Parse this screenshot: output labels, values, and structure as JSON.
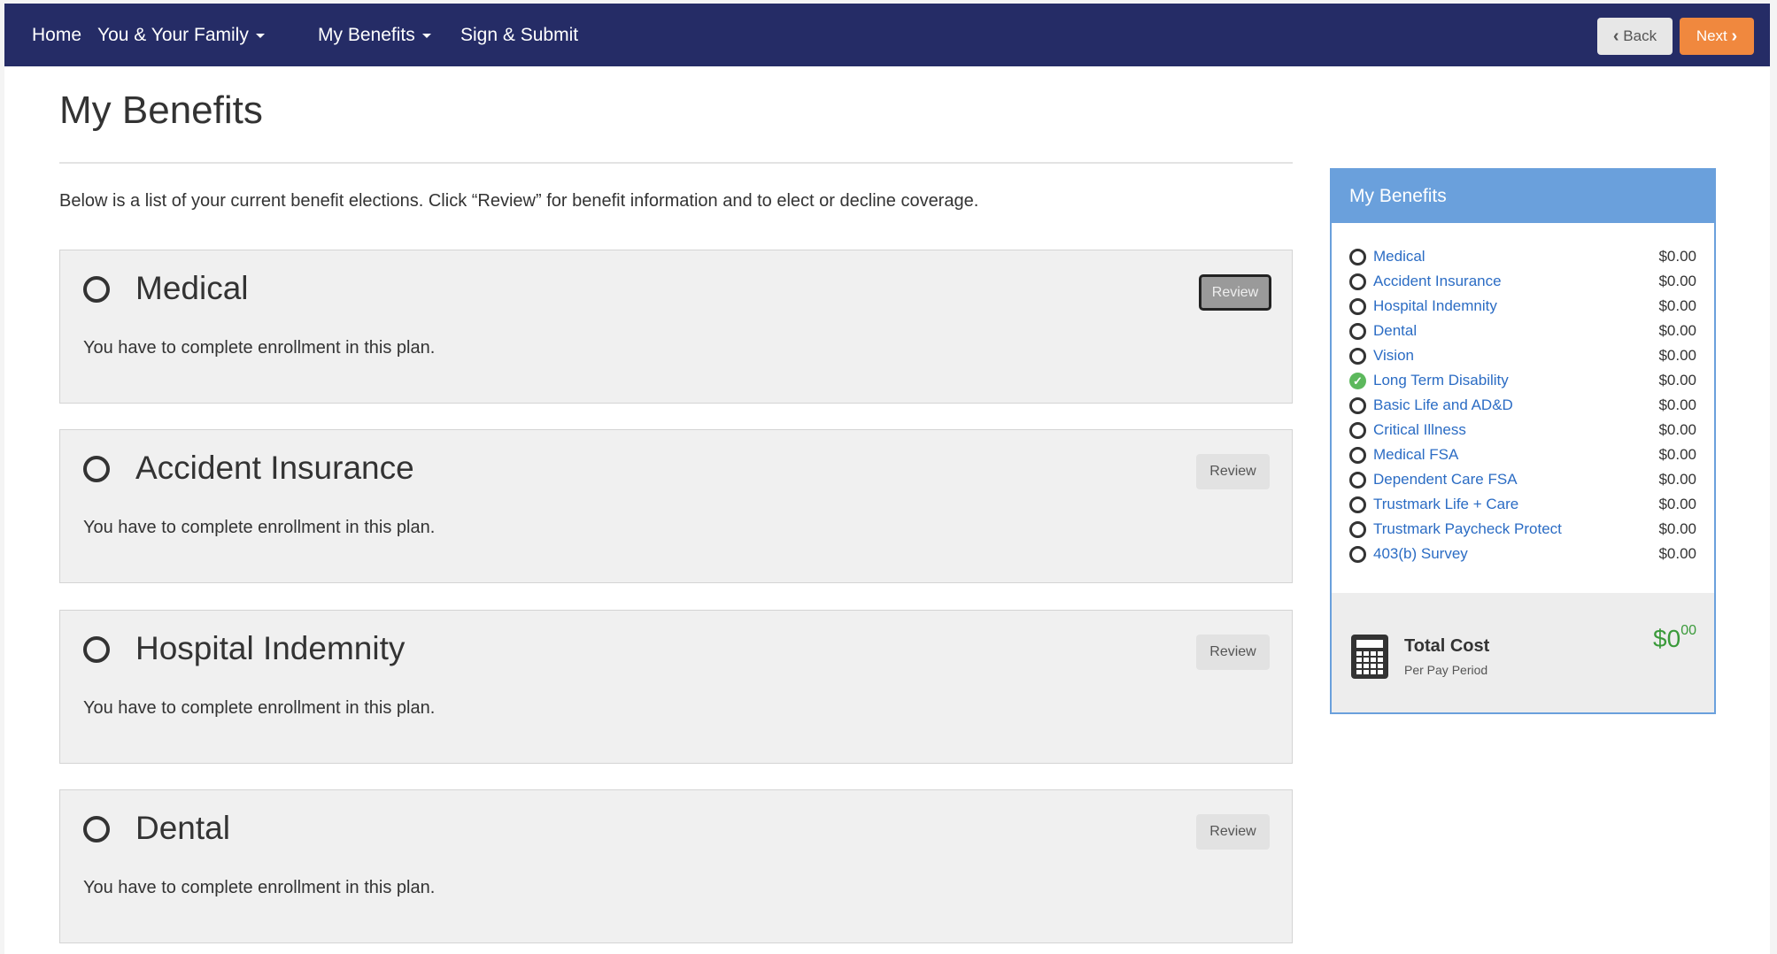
{
  "nav": {
    "items": [
      {
        "label": "Home",
        "dropdown": false
      },
      {
        "label": "You & Your Family",
        "dropdown": true
      },
      {
        "label": "My Benefits",
        "dropdown": true
      },
      {
        "label": "Sign & Submit",
        "dropdown": false
      }
    ],
    "back_label": "Back",
    "next_label": "Next",
    "back_icon": "chevron-left-icon",
    "next_icon": "chevron-right-icon"
  },
  "page": {
    "title": "My Benefits",
    "intro": "Below is a list of your current benefit elections.  Click “Review” for benefit information and to elect or decline coverage."
  },
  "plans": [
    {
      "name": "Medical",
      "status": "You have to complete enrollment in this plan.",
      "review_label": "Review"
    },
    {
      "name": "Accident Insurance",
      "status": "You have to complete enrollment in this plan.",
      "review_label": "Review"
    },
    {
      "name": "Hospital Indemnity",
      "status": "You have to complete enrollment in this plan.",
      "review_label": "Review"
    },
    {
      "name": "Dental",
      "status": "You have to complete enrollment in this plan.",
      "review_label": "Review"
    }
  ],
  "sidebar": {
    "title": "My Benefits",
    "items": [
      {
        "label": "Medical",
        "price": "$0.00",
        "completed": false
      },
      {
        "label": "Accident Insurance",
        "price": "$0.00",
        "completed": false
      },
      {
        "label": "Hospital Indemnity",
        "price": "$0.00",
        "completed": false
      },
      {
        "label": "Dental",
        "price": "$0.00",
        "completed": false
      },
      {
        "label": "Vision",
        "price": "$0.00",
        "completed": false
      },
      {
        "label": "Long Term Disability",
        "price": "$0.00",
        "completed": true
      },
      {
        "label": "Basic Life and AD&D",
        "price": "$0.00",
        "completed": false
      },
      {
        "label": "Critical Illness",
        "price": "$0.00",
        "completed": false
      },
      {
        "label": "Medical FSA",
        "price": "$0.00",
        "completed": false
      },
      {
        "label": "Dependent Care FSA",
        "price": "$0.00",
        "completed": false
      },
      {
        "label": "Trustmark Life + Care",
        "price": "$0.00",
        "completed": false
      },
      {
        "label": "Trustmark Paycheck Protect",
        "price": "$0.00",
        "completed": false
      },
      {
        "label": "403(b) Survey",
        "price": "$0.00",
        "completed": false
      }
    ],
    "total": {
      "label": "Total Cost",
      "sub_label": "Per Pay Period",
      "dollars": "$0",
      "cents": "00",
      "icon": "calculator-icon"
    }
  },
  "colors": {
    "navbar": "#252c66",
    "next_button": "#f0883e",
    "panel_accent": "#6aa0dc",
    "link": "#2b6cc4",
    "total": "#3a9a3a",
    "check": "#5cb85c"
  }
}
